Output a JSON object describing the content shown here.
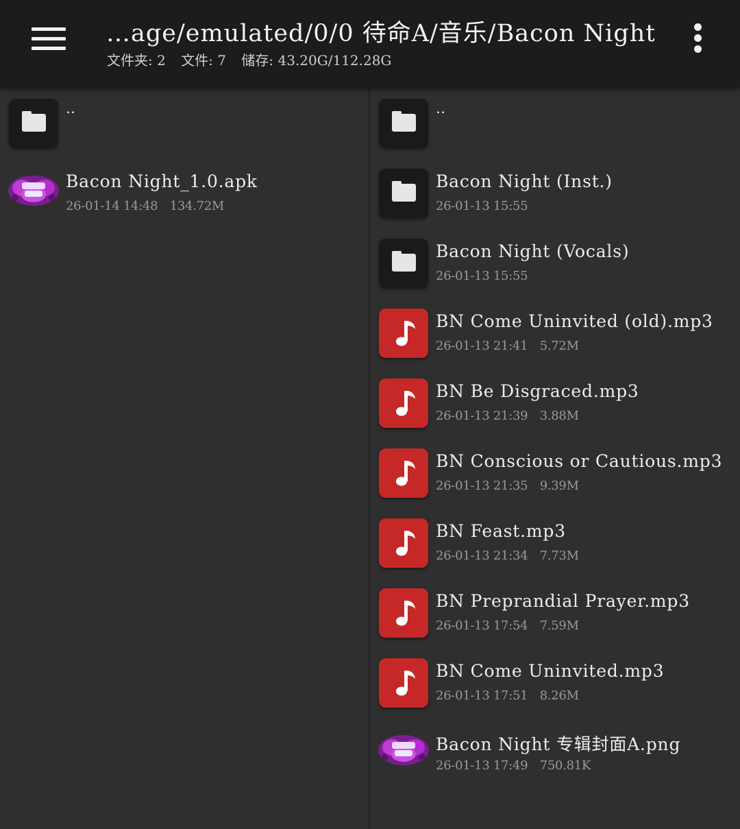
{
  "header": {
    "path": "…age/emulated/0/0 待命A/音乐/Bacon Night/",
    "folders": "文件夹: 2",
    "files": "文件: 7",
    "storage": "储存: 43.20G/112.28G"
  },
  "left_pane": {
    "up_item": {
      "name": "..",
      "icon": "folder-icon"
    },
    "items": [
      {
        "name": "Bacon Night_1.0.apk",
        "date": "26-01-14 14:48",
        "size": "134.72M",
        "icon": "app-thumbnail"
      }
    ]
  },
  "right_pane": {
    "up_item": {
      "name": "..",
      "icon": "folder-icon"
    },
    "items": [
      {
        "name": "Bacon Night (Inst.)",
        "date": "26-01-13 15:55",
        "size": "",
        "icon": "folder-icon"
      },
      {
        "name": "Bacon Night (Vocals)",
        "date": "26-01-13 15:55",
        "size": "",
        "icon": "folder-icon"
      },
      {
        "name": "BN Come Uninvited (old).mp3",
        "date": "26-01-13 21:41",
        "size": "5.72M",
        "icon": "music-note-icon"
      },
      {
        "name": "BN Be Disgraced.mp3",
        "date": "26-01-13 21:39",
        "size": "3.88M",
        "icon": "music-note-icon"
      },
      {
        "name": "BN Conscious or Cautious.mp3",
        "date": "26-01-13 21:35",
        "size": "9.39M",
        "icon": "music-note-icon"
      },
      {
        "name": "BN Feast.mp3",
        "date": "26-01-13 21:34",
        "size": "7.73M",
        "icon": "music-note-icon"
      },
      {
        "name": "BN Preprandial Prayer.mp3",
        "date": "26-01-13 17:54",
        "size": "7.59M",
        "icon": "music-note-icon"
      },
      {
        "name": "BN Come Uninvited.mp3",
        "date": "26-01-13 17:51",
        "size": "8.26M",
        "icon": "music-note-icon"
      },
      {
        "name": "Bacon Night 专辑封面A.png",
        "date": "26-01-13 17:49",
        "size": "750.81K",
        "icon": "image-thumbnail"
      }
    ]
  },
  "colors": {
    "background": "#2e2e2e",
    "header": "#1c1c1c",
    "folder_tile": "#1a1a1a",
    "music_tile": "#c62828",
    "primary_text": "#ececec",
    "secondary_text": "#9a9a9a"
  }
}
